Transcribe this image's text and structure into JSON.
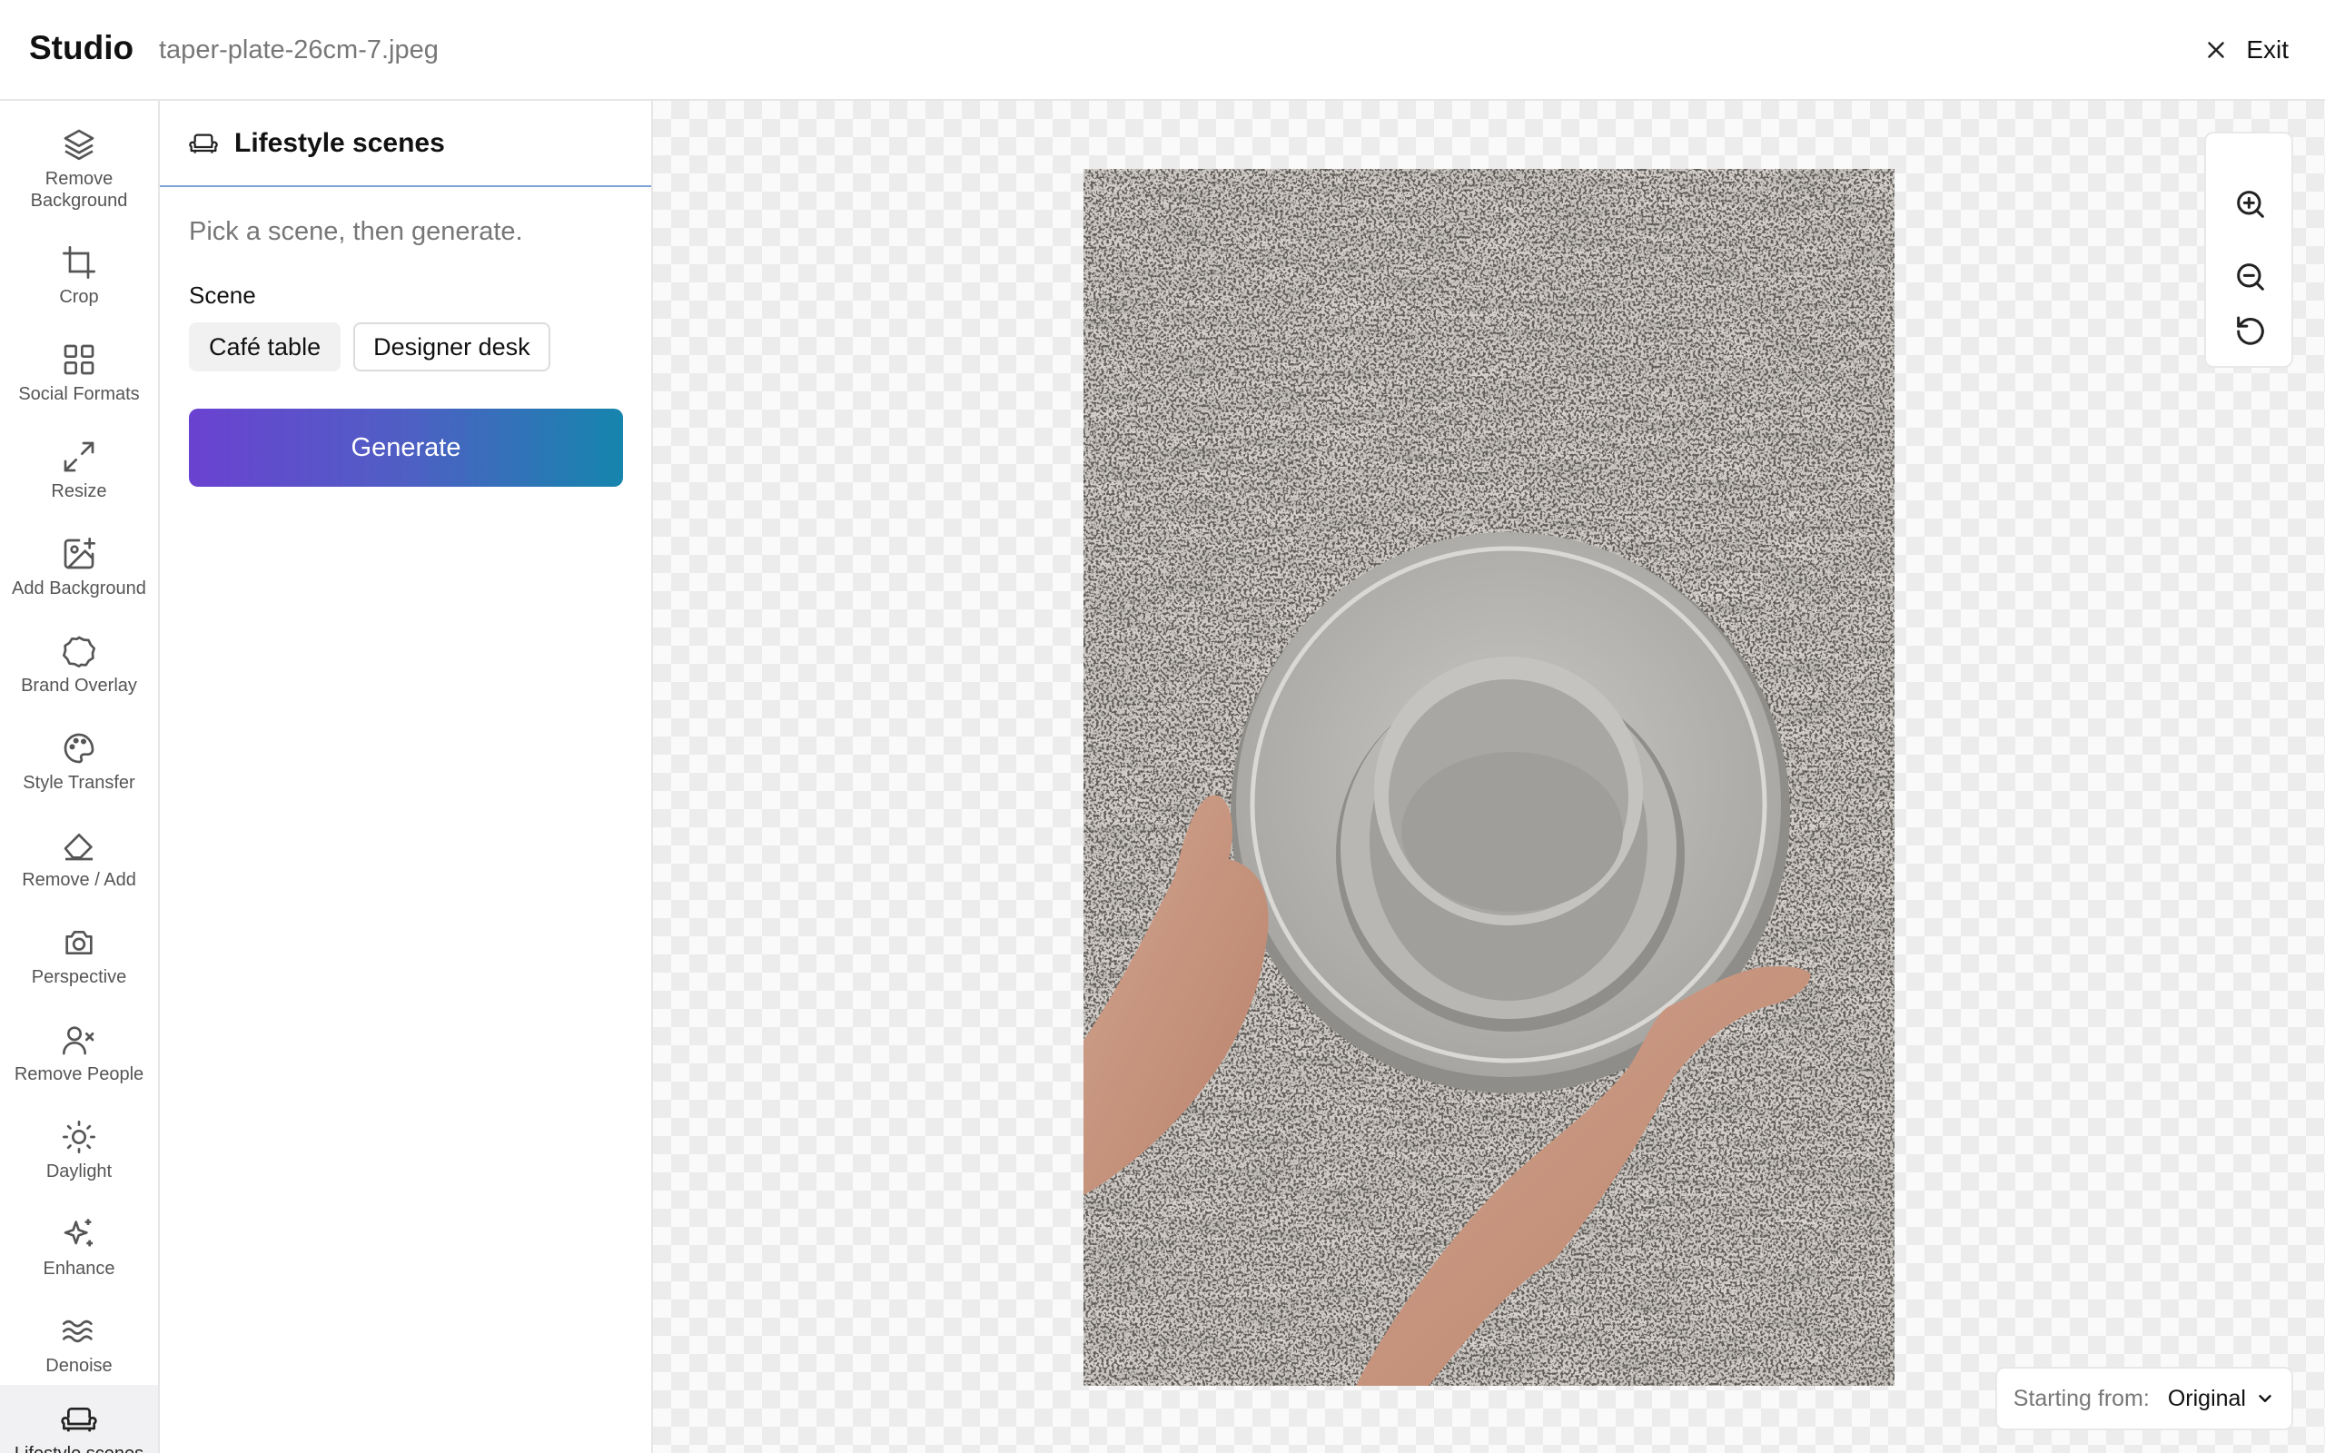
{
  "header": {
    "app_title": "Studio",
    "file_name": "taper-plate-26cm-7.jpeg",
    "exit_label": "Exit"
  },
  "tools": [
    {
      "label": "Remove\nBackground",
      "icon": "layers-icon"
    },
    {
      "label": "Crop",
      "icon": "crop-icon"
    },
    {
      "label": "Social Formats",
      "icon": "grid-icon"
    },
    {
      "label": "Resize",
      "icon": "resize-icon"
    },
    {
      "label": "Add Background",
      "icon": "image-plus-icon"
    },
    {
      "label": "Brand Overlay",
      "icon": "badge-icon"
    },
    {
      "label": "Style Transfer",
      "icon": "palette-icon"
    },
    {
      "label": "Remove / Add",
      "icon": "eraser-icon"
    },
    {
      "label": "Perspective",
      "icon": "camera-icon"
    },
    {
      "label": "Remove People",
      "icon": "user-x-icon"
    },
    {
      "label": "Daylight",
      "icon": "sun-icon"
    },
    {
      "label": "Enhance",
      "icon": "sparkles-icon"
    },
    {
      "label": "Denoise",
      "icon": "waves-icon"
    },
    {
      "label": "Lifestyle scenes",
      "icon": "sofa-icon"
    }
  ],
  "panel": {
    "title": "Lifestyle scenes",
    "hint": "Pick a scene, then generate.",
    "scene_label": "Scene",
    "scenes": [
      "Café table",
      "Designer desk"
    ],
    "selected_scene": "Café table",
    "generate_label": "Generate"
  },
  "canvas": {
    "starting_from_label": "Starting from:",
    "starting_from_value": "Original"
  },
  "colors": {
    "accent_start": "#6a42d1",
    "accent_end": "#1585ad"
  }
}
